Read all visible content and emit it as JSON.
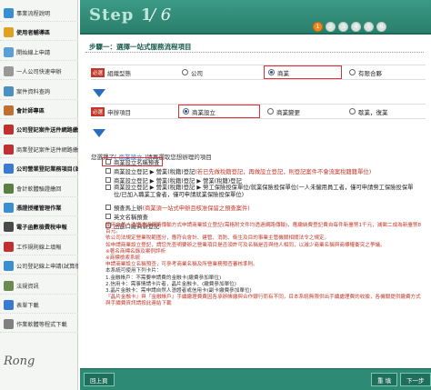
{
  "sidebar": {
    "items": [
      {
        "label": "事業流程說明",
        "color": "#3a8fd0",
        "bold": false
      },
      {
        "label": "使用者輔導區",
        "color": "#e0a020",
        "bold": true
      },
      {
        "label": "開始線上申請",
        "color": "#5aa0d8",
        "bold": false
      },
      {
        "label": "一人公司快速申辦",
        "color": "#999999",
        "bold": false
      },
      {
        "label": "案件資料查詢",
        "color": "#4a90c0",
        "bold": false
      },
      {
        "label": "會計師專區",
        "color": "#c07030",
        "bold": true
      },
      {
        "label": "公司登記案件送件網路繳費",
        "color": "#c03030",
        "bold": true
      },
      {
        "label": "商業登記案件送件網路繳費",
        "color": "#c03030",
        "bold": false
      },
      {
        "label": "公司營業登記業務項目(試辦版)",
        "color": "#3a7ad0",
        "bold": true
      },
      {
        "label": "會計軟體驗證繳回",
        "color": "#5a8040",
        "bold": false
      },
      {
        "label": "憑證授權管理作業",
        "color": "#3a8fd0",
        "bold": true
      },
      {
        "label": "電子函數檢費稅申報",
        "color": "#4a4a4a",
        "bold": true
      },
      {
        "label": "工作規則線上填報",
        "color": "#c03030",
        "bold": false
      },
      {
        "label": "公司登記線上申請(試算版)",
        "color": "#3a8fd0",
        "bold": false
      },
      {
        "label": "法規資訊",
        "color": "#6a8a50",
        "bold": false
      },
      {
        "label": "表單下載",
        "color": "#3a7ad0",
        "bold": false
      },
      {
        "label": "作業軟體等程式下載",
        "color": "#808080",
        "bold": false
      }
    ],
    "logo": "Rong"
  },
  "header": {
    "step_label": "Step 1",
    "step_total": "/ 6",
    "steps": [
      "1",
      "2",
      "3",
      "4",
      "5",
      "6"
    ],
    "active_step": 1
  },
  "main": {
    "title": "步驟一：選擇一站式服務流程項目",
    "org_row": {
      "required": "必選",
      "label": "組織型態",
      "options": [
        "公司",
        "商業",
        "有限合夥"
      ],
      "selected": 1
    },
    "app_row": {
      "required": "必選",
      "label": "申辦項目",
      "options": [
        "商業設立",
        "商業變更",
        "歇業，復業"
      ],
      "selected": 0
    },
    "selection_text": "您選擇了",
    "selection_value": "[ 商業設立 ]",
    "selection_suffix": "請再選取您想辦理的項目",
    "checklist": [
      {
        "text": "商業設立名稱預查",
        "note": ""
      },
      {
        "text": "商業設立登記 ▶ 營業(稅籍)登記",
        "note": "(若已先做稅籍登記，再做設立登記，則登記案件不會流案稅籍籍單位)"
      },
      {
        "text": "商業設立登記 ▶ 營業(稅籍)登記 ▶ 營業(稅籍)登記",
        "note": ""
      },
      {
        "text": "商業設立登記 ▶ 營業(稅籍)登記 ▶ 勞工保險投保單位/就業保險投保單位(一人未僱用員工者，僅可申請勞工保險投保單位/已加入職業工會者，僅可申請就業保險投保單位)",
        "note": ""
      },
      {
        "text": "預查馬上辦",
        "note": "(商業須一站式申辦且核准保留之預查案件)"
      },
      {
        "text": "英文名稱預查",
        "note": ""
      },
      {
        "text": "出進口廠商新登記",
        "note": ""
      }
    ],
    "notes": [
      "使用自然人憑證透過網路傳輸方式申請商業設立登記(需格附文件均透過網路傳輸)，應繳納費登記費自每件新臺幣1千元，減徵二成為新臺幣8百元。",
      "依公司法規定營業稅範圍分，應符合會計、建管、消防、衛生及目的事業主管機關相關法令之規定。",
      "如申請商業設立登記，請您先查明要辦之營業項目是否須許可及名稱是否與他人相同，以減少商業名稱與商標權衝突之爭議。",
      "※著名商標名錄及案例評析",
      "※商標檢索系統",
      "申請商業設立名稱預查，可參考商業名稱及所營業務預查審核準則。",
      "本系統可使用下列卡片：",
      "1.金融帳戶：不需要申請費的金融卡(繳費參加單位)",
      "2.信用卡：需事情請卡片者，晶片金融卡、(繳費參加單位)",
      "3.晶片金融卡：需申請自然人憑證者或信用卡(副卡繳費參加單位)",
      "『晶片金融卡』與『金融帳戶』手續繳理費費因各承辦帳繳與合作銀行而有不同，目本系統無限供出手續處理費的收據，各機關提供繳費方式與手續費資訊請按此連結下載"
    ]
  },
  "footer": {
    "back": "回上頁",
    "reset": "重 填",
    "next": "下一步"
  },
  "colors": {
    "header": "#2a7f6c",
    "accent": "#f08a1e",
    "highlight": "#d9303a"
  }
}
